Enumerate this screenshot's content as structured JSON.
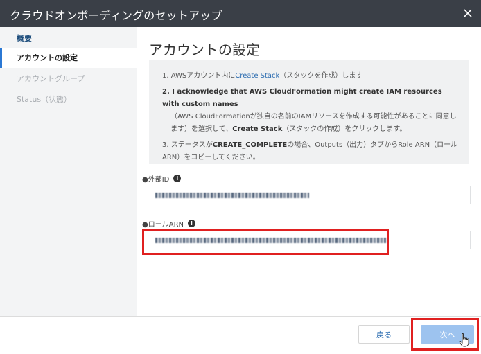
{
  "window": {
    "title": "クラウドオンボーディングのセットアップ",
    "close_icon": "close-icon"
  },
  "sidebar": {
    "items": [
      {
        "label": "概要"
      },
      {
        "label": "アカウントの設定"
      },
      {
        "label": "アカウントグループ"
      },
      {
        "label": "Status（状態）"
      }
    ]
  },
  "main": {
    "heading": "アカウントの設定",
    "steps": {
      "s1_pre": "1. AWSアカウント内に",
      "s1_link": "Create Stack",
      "s1_post": "（スタックを作成）します",
      "s2_bold": "2. I acknowledge that AWS CloudFormation might create IAM resources with custom names",
      "s2_mid": "（AWS CloudFormationが独自の名前のIAMリソースを作成する可能性があることに同意します）を選択して、",
      "s2_bold2": "Create Stack",
      "s2_end": "（スタックの作成）をクリックします。",
      "s3_pre": "3. ステータスが",
      "s3_bold": "CREATE_COMPLETE",
      "s3_post": "の場合、Outputs（出力）タブからRole ARN（ロールARN）をコピーしてください。"
    },
    "external_id": {
      "label": "●外部ID"
    },
    "role_arn": {
      "label": "●ロールARN"
    }
  },
  "footer": {
    "back_label": "戻る",
    "next_label": "次へ"
  },
  "colors": {
    "title_bar": "#3a3f47",
    "accent": "#2b78d4",
    "highlight": "#e02020",
    "next_button": "#9dc3ef"
  }
}
